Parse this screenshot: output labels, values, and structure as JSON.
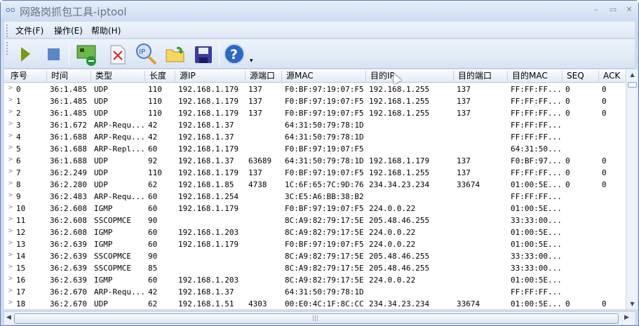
{
  "window": {
    "title": "网路岗抓包工具-iptool",
    "logo": "ᴑᴑ",
    "minimize": "–",
    "maximize": "▭",
    "close": "✕"
  },
  "menu": [
    "文件(F)",
    "操作(E)",
    "帮助(H)"
  ],
  "toolbar": {
    "icons": [
      "play-icon",
      "stop-icon",
      "network-card-icon",
      "delete-file-icon",
      "ip-search-icon",
      "open-folder-icon",
      "save-icon",
      "help-icon"
    ],
    "overflow": "▾"
  },
  "table": {
    "columns": [
      "序号",
      "时间",
      "类型",
      "长度",
      "源IP",
      "源端口",
      "源MAC",
      "目的IP",
      "目的端口",
      "目的MAC",
      "SEQ",
      "ACK"
    ],
    "rows": [
      [
        "0",
        "36:1.485",
        "UDP",
        "110",
        "192.168.1.179",
        "137",
        "F0:BF:97:19:07:F5",
        "192.168.1.255",
        "137",
        "FF:FF:FF...",
        "0",
        "0"
      ],
      [
        "1",
        "36:1.485",
        "UDP",
        "110",
        "192.168.1.179",
        "137",
        "F0:BF:97:19:07:F5",
        "192.168.1.255",
        "137",
        "FF:FF:FF...",
        "0",
        "0"
      ],
      [
        "2",
        "36:1.485",
        "UDP",
        "110",
        "192.168.1.179",
        "137",
        "F0:BF:97:19:07:F5",
        "192.168.1.255",
        "137",
        "FF:FF:FF...",
        "0",
        "0"
      ],
      [
        "3",
        "36:1.672",
        "ARP-Requ...",
        "42",
        "192.168.1.37",
        "",
        "64:31:50:79:78:1D",
        "",
        "",
        "FF:FF:FF...",
        "",
        ""
      ],
      [
        "4",
        "36:1.688",
        "ARP-Requ...",
        "42",
        "192.168.1.37",
        "",
        "64:31:50:79:78:1D",
        "",
        "",
        "FF:FF:FF...",
        "",
        ""
      ],
      [
        "5",
        "36:1.688",
        "ARP-Repl...",
        "60",
        "192.168.1.179",
        "",
        "F0:BF:97:19:07:F5",
        "",
        "",
        "64:31:50...",
        "",
        ""
      ],
      [
        "6",
        "36:1.688",
        "UDP",
        "92",
        "192.168.1.37",
        "63689",
        "64:31:50:79:78:1D",
        "192.168.1.179",
        "137",
        "F0:BF:97...",
        "0",
        "0"
      ],
      [
        "7",
        "36:2.249",
        "UDP",
        "110",
        "192.168.1.179",
        "137",
        "F0:BF:97:19:07:F5",
        "192.168.1.255",
        "137",
        "FF:FF:FF...",
        "0",
        "0"
      ],
      [
        "8",
        "36:2.280",
        "UDP",
        "62",
        "192.168.1.85",
        "4738",
        "1C:6F:65:7C:9D:76",
        "234.34.23.234",
        "33674",
        "01:00:5E...",
        "0",
        "0"
      ],
      [
        "9",
        "36:2.483",
        "ARP-Requ...",
        "60",
        "192.168.1.254",
        "",
        "3C:E5:A6:BB:38:B2",
        "",
        "",
        "FF:FF:FF...",
        "",
        ""
      ],
      [
        "10",
        "36:2.608",
        "IGMP",
        "60",
        "192.168.1.179",
        "",
        "F0:BF:97:19:07:F5",
        "224.0.0.22",
        "",
        "01:00:5E...",
        "",
        ""
      ],
      [
        "11",
        "36:2.608",
        "SSCOPMCE",
        "90",
        "",
        "",
        "8C:A9:82:79:17:5E",
        "205.48.46.255",
        "",
        "33:33:00...",
        "",
        ""
      ],
      [
        "12",
        "36:2.608",
        "IGMP",
        "60",
        "192.168.1.203",
        "",
        "8C:A9:82:79:17:5E",
        "224.0.0.22",
        "",
        "01:00:5E...",
        "",
        ""
      ],
      [
        "13",
        "36:2.639",
        "IGMP",
        "60",
        "192.168.1.179",
        "",
        "F0:BF:97:19:07:F5",
        "224.0.0.22",
        "",
        "01:00:5E...",
        "",
        ""
      ],
      [
        "14",
        "36:2.639",
        "SSCOPMCE",
        "90",
        "",
        "",
        "8C:A9:82:79:17:5E",
        "205.48.46.255",
        "",
        "33:33:00...",
        "",
        ""
      ],
      [
        "15",
        "36:2.639",
        "SSCOPMCE",
        "85",
        "",
        "",
        "8C:A9:82:79:17:5E",
        "205.48.46.255",
        "",
        "33:33:00...",
        "",
        ""
      ],
      [
        "16",
        "36:2.639",
        "IGMP",
        "60",
        "192.168.1.203",
        "",
        "8C:A9:82:79:17:5E",
        "224.0.0.22",
        "",
        "01:00:5E...",
        "",
        ""
      ],
      [
        "17",
        "36:2.670",
        "ARP-Requ...",
        "42",
        "192.168.1.37",
        "",
        "64:31:50:79:78:1D",
        "",
        "",
        "FF:FF:FF...",
        "",
        ""
      ],
      [
        "18",
        "36:2.670",
        "UDP",
        "62",
        "192.168.1.51",
        "4303",
        "00:E0:4C:1F:8C:CC",
        "234.34.23.234",
        "33674",
        "01:00:5E...",
        "0",
        "0"
      ]
    ]
  },
  "scrollbar": {
    "up": "▲",
    "down": "▼",
    "left": "◀",
    "right": "▶",
    "grip": "|||"
  }
}
